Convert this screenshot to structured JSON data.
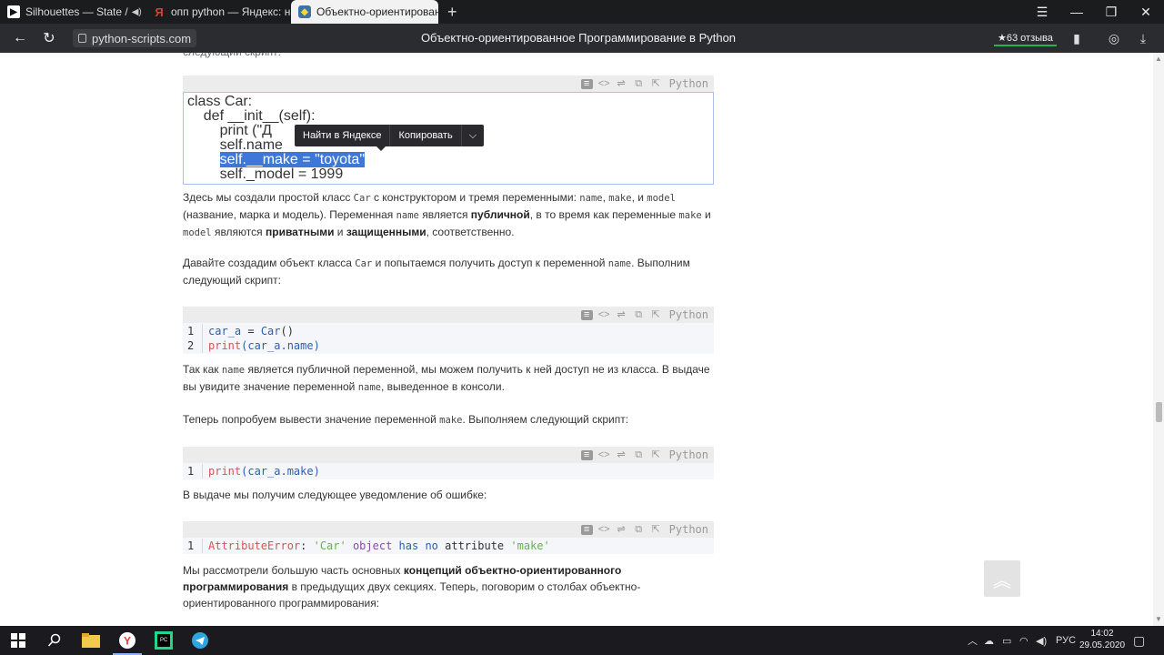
{
  "browser": {
    "tabs": [
      {
        "label": "Silhouettes — State /",
        "icon": "play-icon",
        "active": false
      },
      {
        "label": "опп python — Яндекс: нашлось",
        "icon": "yandex-icon",
        "active": false
      },
      {
        "label": "Объектно-ориентированное",
        "icon": "python-icon",
        "active": true
      }
    ],
    "new_tab": "+",
    "url": "python-scripts.com",
    "page_title": "Объектно-ориентированное Программирование в Python",
    "reviews": "★63 отзыва"
  },
  "code_blocks": {
    "lang": "Python",
    "block1": {
      "lines": [
        "class Car:",
        "    def __init__(self):",
        "        print (\"Д",
        "        self.name",
        "        self.__make = \"toyota\"",
        "        self._model = 1999"
      ]
    },
    "block2": {
      "nums": [
        "1",
        "2"
      ],
      "line1": {
        "a": "car_a",
        "b": " = ",
        "c": "Car",
        "d": "()"
      },
      "line2": {
        "a": "print",
        "b": "(car_a.name)"
      }
    },
    "block3": {
      "nums": [
        "1"
      ],
      "line1": {
        "a": "print",
        "b": "(car_a.make)"
      }
    },
    "block4": {
      "nums": [
        "1"
      ],
      "line1": {
        "a": "AttributeError",
        "b": ": ",
        "c": "'Car'",
        "d": " object ",
        "e": "has",
        "f": " ",
        "g": "no",
        "h": " attribute ",
        "i": "'make'"
      }
    }
  },
  "context_menu": {
    "find": "Найти в Яндексе",
    "copy": "Копировать"
  },
  "text": {
    "cut_top": "следующий скрипт:",
    "p1": {
      "a": "Здесь мы создали простой класс ",
      "b": "Car",
      "c": " с конструктором и тремя переменными: ",
      "d": "name",
      "e": ", ",
      "f": "make",
      "g": ", и ",
      "h": "model",
      "i": " (название, марка и модель). Переменная ",
      "j": "name",
      "k": " является ",
      "l": "публичной",
      "m": ", в то время как переменные ",
      "n": "make",
      "o": " и ",
      "p": "model",
      "q": " являются ",
      "r": "приватными",
      "s": " и ",
      "t": "защищенными",
      "u": ", соответственно."
    },
    "p2": {
      "a": "Давайте создадим объект класса ",
      "b": "Car",
      "c": " и попытаемся получить доступ к переменной ",
      "d": "name",
      "e": ". Выполним следующий скрипт:"
    },
    "p3": {
      "a": "Так как ",
      "b": "name",
      "c": " является публичной переменной, мы можем получить к ней доступ не из класса. В выдаче вы увидите значение переменной ",
      "d": "name",
      "e": ", выведенное в консоли."
    },
    "p4": {
      "a": "Теперь попробуем вывести значение переменной ",
      "b": "make",
      "c": ". Выполняем следующий скрипт:"
    },
    "p5": "В выдаче мы получим следующее уведомление об ошибке:",
    "p6": {
      "a": "Мы рассмотрели большую часть основных ",
      "b": "концепций объектно-ориентированного программирования",
      "c": " в предыдущих двух секциях. Теперь, поговорим о столбах объектно-ориентированного программирования:"
    }
  },
  "taskbar": {
    "lang": "РУС",
    "time": "14:02",
    "date": "29.05.2020"
  },
  "colors": {
    "selection": "#3d78d8",
    "keyword_red": "#d9534f",
    "keyword_blue": "#2b5fb4",
    "string_green": "#6ab04c"
  }
}
